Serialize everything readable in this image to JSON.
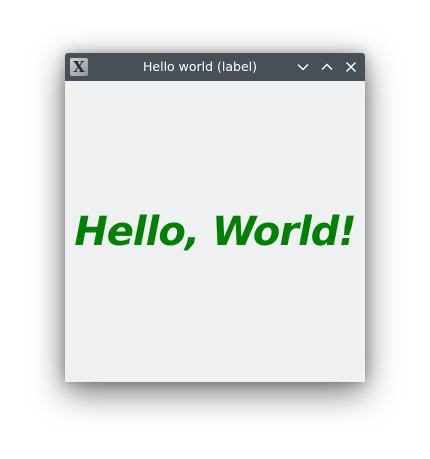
{
  "window": {
    "title": "Hello world (label)",
    "app_icon": "x-logo-icon",
    "controls": {
      "minimize_icon": "chevron-down-icon",
      "maximize_icon": "chevron-up-icon",
      "close_icon": "close-icon"
    }
  },
  "content": {
    "label_text": "Hello, World!",
    "label_color": "#008000",
    "background_color": "#eff0f1"
  },
  "colors": {
    "titlebar": "#475057",
    "title_text": "#ffffff"
  }
}
